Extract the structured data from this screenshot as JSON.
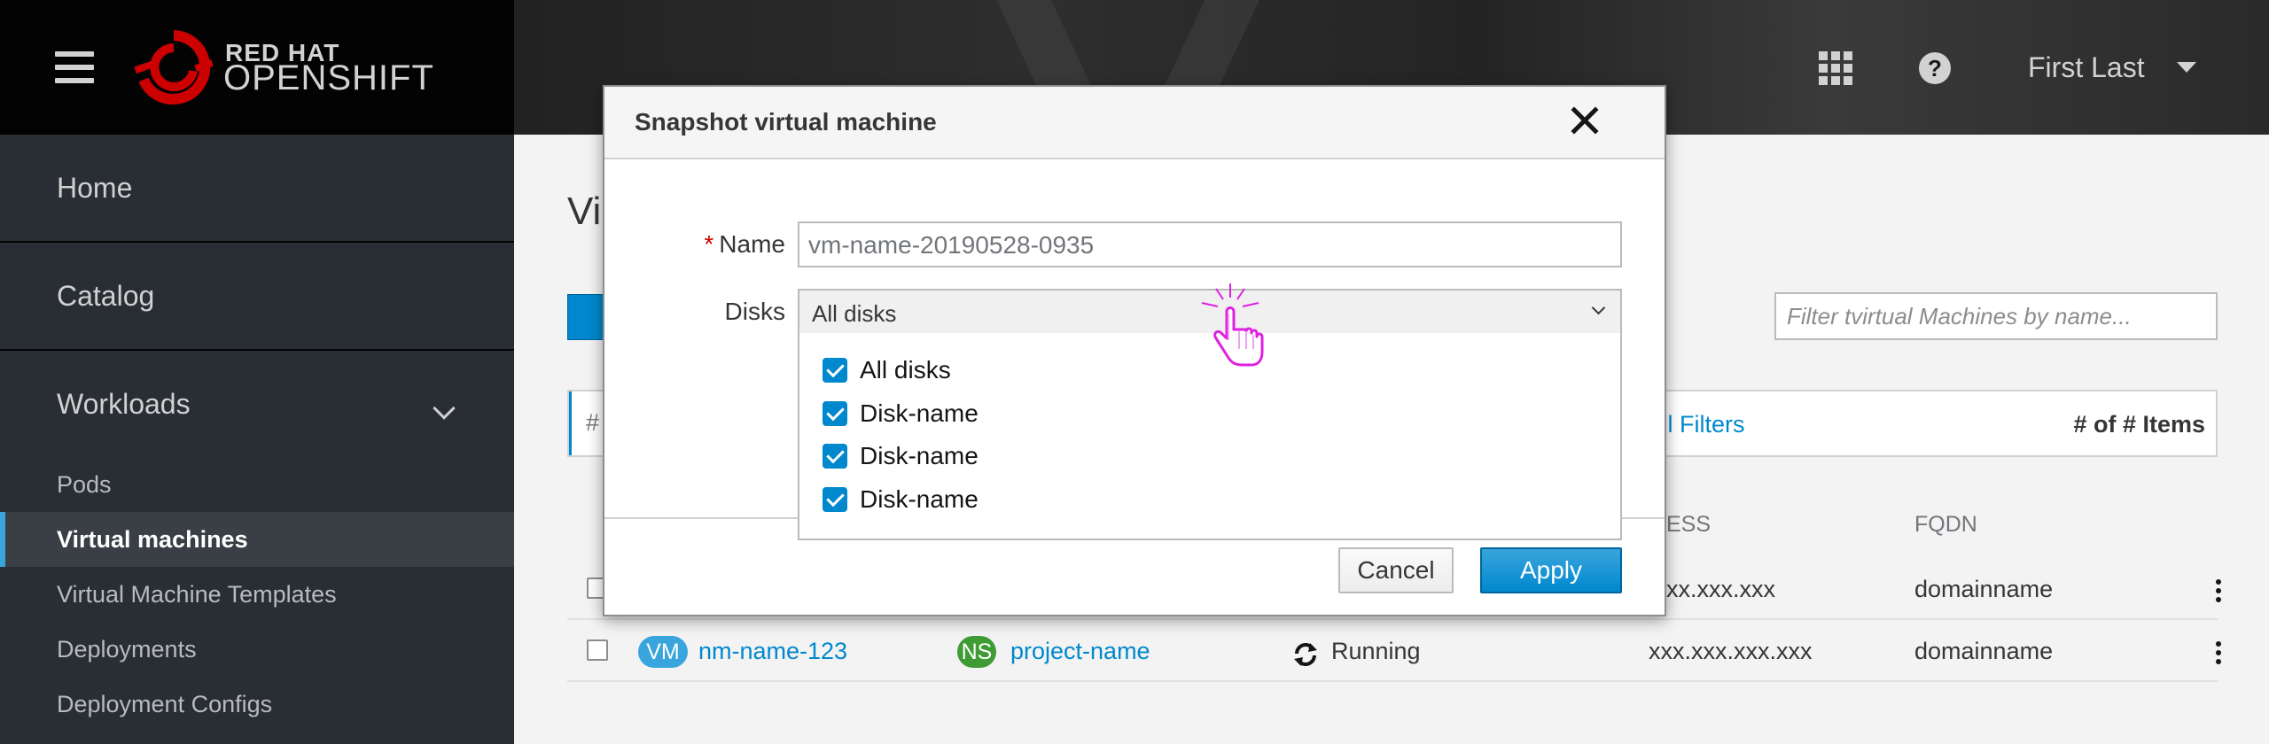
{
  "masthead": {
    "brand_line1": "RED HAT",
    "brand_line2": "OPENSHIFT",
    "user_name": "First Last",
    "icons": [
      "menu-icon",
      "app-launcher-icon",
      "help-icon",
      "caret-down-icon"
    ]
  },
  "sidebar": {
    "sections": [
      {
        "label": "Home"
      },
      {
        "label": "Catalog"
      },
      {
        "label": "Workloads"
      }
    ],
    "workloads_items": [
      {
        "label": "Pods"
      },
      {
        "label": "Virtual machines",
        "active": true
      },
      {
        "label": "Virtual Machine Templates"
      },
      {
        "label": "Deployments"
      },
      {
        "label": "Deployment Configs"
      }
    ]
  },
  "main": {
    "title_partial": "Vi",
    "filter_placeholder": "Filter tvirtual Machines by name...",
    "clear_filters": "t All Filters",
    "items_count": "# of # Items",
    "toolbar_select_partial": "#",
    "columns": {
      "address_partial": "ESS",
      "fqdn": "FQDN"
    },
    "rows": [
      {
        "address": "xx.xxx.xxx",
        "fqdn": "domainname"
      },
      {
        "vm_badge": "VM",
        "name": "nm-name-123",
        "ns_badge": "NS",
        "project": "project-name",
        "status": "Running",
        "address": "xxx.xxx.xxx.xxx",
        "fqdn": "domainname"
      }
    ]
  },
  "modal": {
    "title": "Snapshot virtual machine",
    "name_label": "Name",
    "required_marker": "*",
    "name_value": "vm-name-20190528-0935",
    "disks_label": "Disks",
    "disks_selected": "All disks",
    "disk_options": [
      {
        "label": "All disks",
        "checked": true
      },
      {
        "label": "Disk-name",
        "checked": true
      },
      {
        "label": "Disk-name",
        "checked": true
      },
      {
        "label": "Disk-name",
        "checked": true
      }
    ],
    "cancel_label": "Cancel",
    "apply_label": "Apply"
  },
  "colors": {
    "accent": "#0088ce",
    "cursor": "#e020e0",
    "masthead": "#030303",
    "sidebar": "#292e34"
  }
}
